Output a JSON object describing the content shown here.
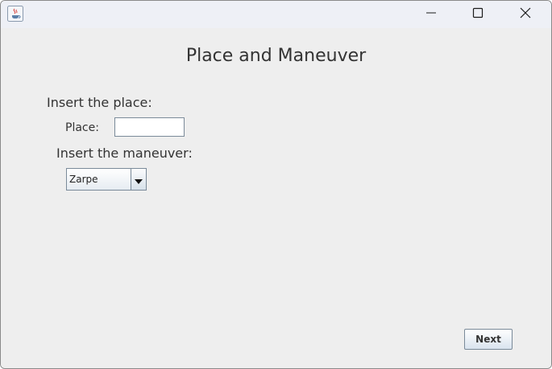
{
  "window": {
    "title": "",
    "controls": {
      "minimize_icon": "minimize-icon",
      "maximize_icon": "maximize-icon",
      "close_icon": "close-icon"
    }
  },
  "main": {
    "heading": "Place and Maneuver",
    "place_section_label": "Insert the place:",
    "place_field_label": "Place:",
    "place_value": "",
    "maneuver_section_label": "Insert the maneuver:",
    "maneuver_selected": "Zarpe",
    "next_label": "Next"
  },
  "colors": {
    "background": "#eeeeee",
    "titlebar": "#eef0f6",
    "text": "#333333"
  }
}
